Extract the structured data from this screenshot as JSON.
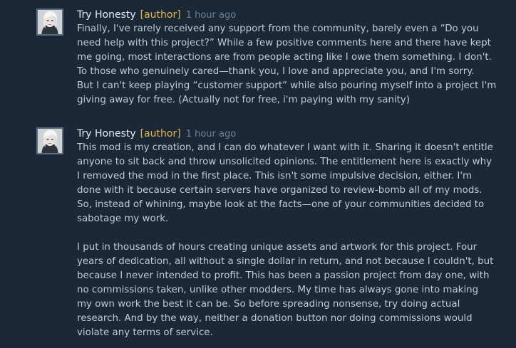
{
  "comments": [
    {
      "author": "Try Honesty",
      "tag": "[author]",
      "time": "1 hour ago",
      "paragraphs": [
        [
          "Finally, I've rarely received any support from the community, barely even a “Do you",
          "need help with this project?” While a few positive comments here and there have kept",
          "me going, most interactions are from people acting like I owe them something. I don't.",
          "To those who genuinely cared—thank you, I love and appreciate you, and I'm sorry.",
          "But I can't keep playing “customer support” while also pouring myself into a project I'm",
          "giving away for free. (Actually not for free, i'm paying with my sanity)"
        ]
      ]
    },
    {
      "author": "Try Honesty",
      "tag": "[author]",
      "time": "1 hour ago",
      "paragraphs": [
        [
          "This mod is my creation, and I can do whatever I want with it. Sharing it doesn't entitle",
          "anyone to sit back and throw unsolicited opinions. The entitlement here is exactly why",
          "I removed the mod in the first place. This isn't some impulsive decision, either. I'm",
          "done with it because certain servers have organized to review-bomb all of my mods.",
          "So, instead of whining, maybe look at the facts—one of your communities decided to",
          "sabotage my work."
        ],
        [
          "I put in thousands of hours creating unique assets and artwork for this project. Four",
          "years of dedication, all without a single dollar in return, and not because I couldn't, but",
          "because I never intended to profit. This has been a passion project from day one, with",
          "no commissions taken, unlike other modders. My time has always gone into making",
          "my own work the best it can be. So before spreading nonsense, try doing actual",
          "research. And by the way, neither a donation button nor doing commissions would",
          "violate any terms of service."
        ]
      ]
    }
  ]
}
